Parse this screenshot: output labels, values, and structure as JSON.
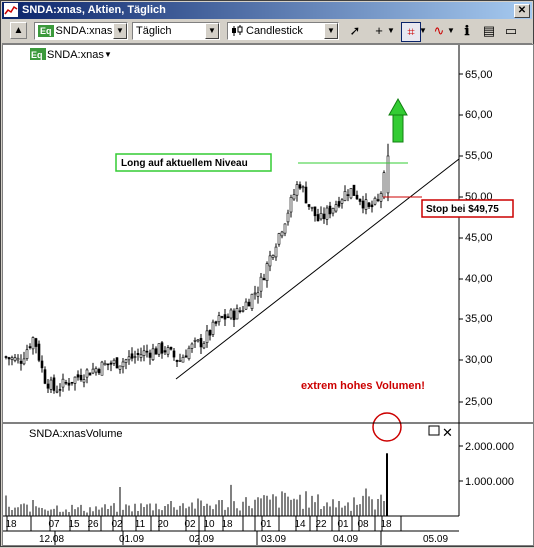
{
  "window": {
    "title": "SNDA:xnas, Aktien, Täglich"
  },
  "toolbar": {
    "symbol_prefix": "Eq",
    "symbol": "SNDA:xnas",
    "interval": "Täglich",
    "chart_style": "Candlestick"
  },
  "chart": {
    "symbol_label": "SNDA:xnas",
    "annotation_long": "Long auf aktuellem Niveau",
    "annotation_stop": "Stop bei $49,75",
    "annotation_volume": "extrem hohes Volumen!",
    "volume_label": "SNDA:xnasVolume",
    "price_ticks": [
      "65,00",
      "60,00",
      "55,00",
      "50,00",
      "45,00",
      "40,00",
      "35,00",
      "30,00",
      "25,00"
    ],
    "volume_ticks": [
      "2.000.000",
      "1.000.000"
    ],
    "day_ticks": [
      "18",
      "07",
      "15",
      "26",
      "02",
      "11",
      "20",
      "02",
      "10",
      "18",
      "01",
      "14",
      "22",
      "01",
      "08",
      "18"
    ],
    "month_ticks": [
      "12.08",
      "01.09",
      "02.09",
      "03.09",
      "04.09",
      "05.09"
    ]
  },
  "chart_data": {
    "type": "candlestick",
    "title": "SNDA:xnas",
    "ylim": [
      22.5,
      68
    ],
    "y_ticks": [
      25,
      30,
      35,
      40,
      45,
      50,
      55,
      60,
      65
    ],
    "x_months": [
      "12.08",
      "01.09",
      "02.09",
      "03.09",
      "04.09",
      "05.09"
    ],
    "levels": {
      "long_entry": 54,
      "stop": 49.75
    },
    "price_path": [
      [
        0,
        30.5
      ],
      [
        16,
        30
      ],
      [
        30,
        33
      ],
      [
        40,
        28
      ],
      [
        50,
        26.5
      ],
      [
        65,
        27.5
      ],
      [
        80,
        28.5
      ],
      [
        100,
        29.5
      ],
      [
        120,
        30
      ],
      [
        140,
        31
      ],
      [
        160,
        31.5
      ],
      [
        175,
        30
      ],
      [
        185,
        31.5
      ],
      [
        200,
        32.5
      ],
      [
        215,
        35
      ],
      [
        235,
        36
      ],
      [
        255,
        39
      ],
      [
        270,
        44
      ],
      [
        280,
        47
      ],
      [
        295,
        52
      ],
      [
        305,
        49
      ],
      [
        315,
        47
      ],
      [
        330,
        49
      ],
      [
        345,
        51
      ],
      [
        355,
        50
      ],
      [
        365,
        48.5
      ],
      [
        375,
        49.5
      ],
      [
        385,
        55
      ]
    ],
    "last_close": 55,
    "last_high": 56.5,
    "volume_ylim": [
      0,
      2400000
    ],
    "volume_path": [
      [
        0,
        220000
      ],
      [
        30,
        350000
      ],
      [
        50,
        300000
      ],
      [
        80,
        250000
      ],
      [
        110,
        280000
      ],
      [
        140,
        320000
      ],
      [
        170,
        400000
      ],
      [
        200,
        380000
      ],
      [
        230,
        420000
      ],
      [
        260,
        500000
      ],
      [
        290,
        600000
      ],
      [
        320,
        450000
      ],
      [
        350,
        400000
      ],
      [
        380,
        500000
      ]
    ],
    "volume_spike": 2150000
  }
}
